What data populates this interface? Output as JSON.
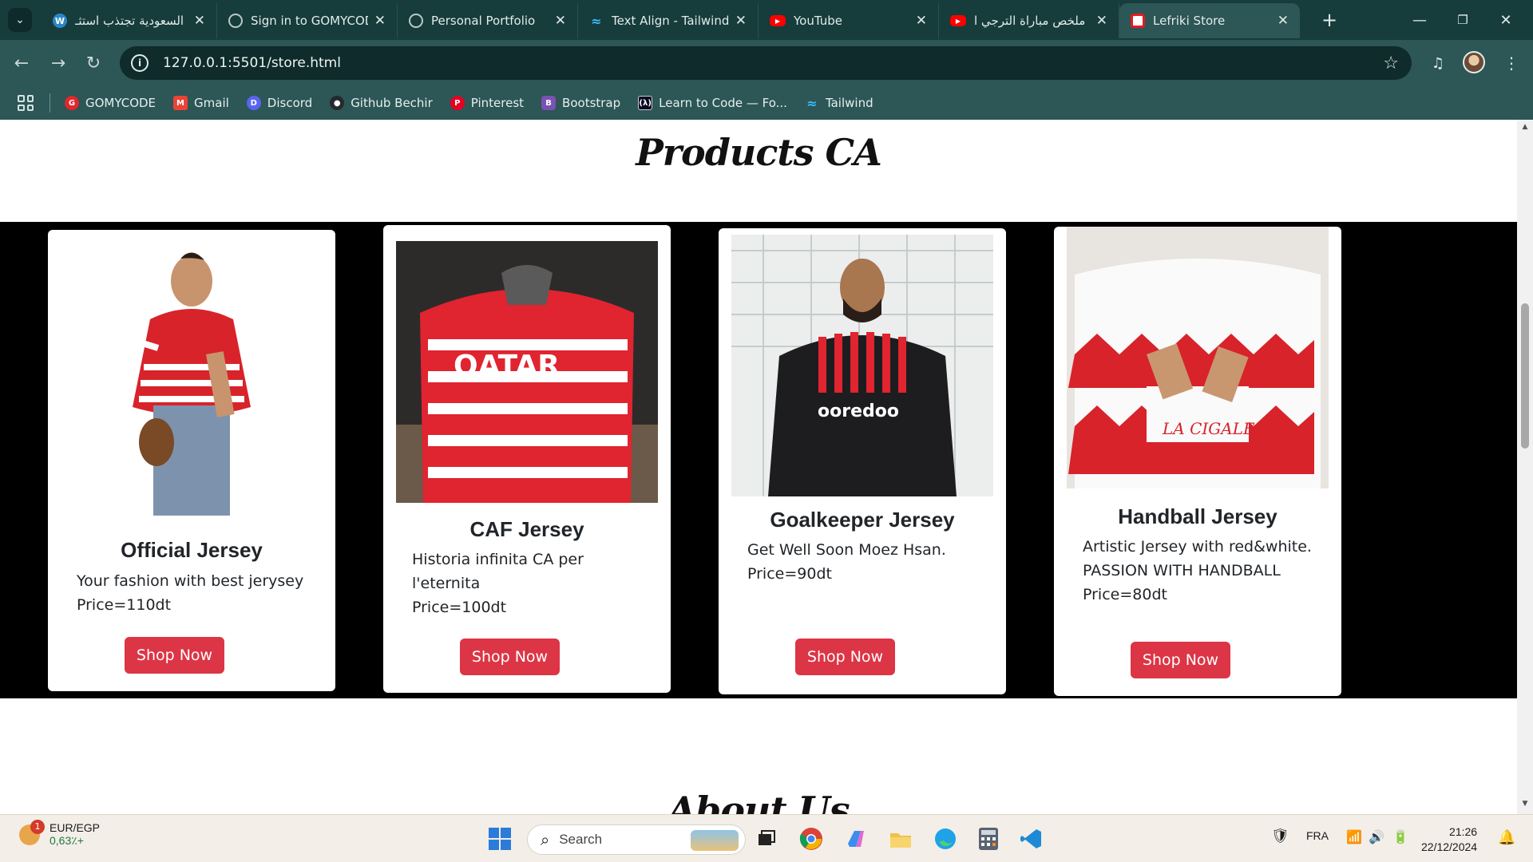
{
  "browser": {
    "tabs": [
      {
        "title": "السعودية تجتذب استثـ",
        "icon": "wordpress-icon",
        "favColor": "#2a86c7"
      },
      {
        "title": "Sign in to GOMYCODE",
        "icon": "globe-icon",
        "favColor": "#6a8a88"
      },
      {
        "title": "Personal Portfolio",
        "icon": "globe-icon",
        "favColor": "#6a8a88"
      },
      {
        "title": "Text Align - Tailwind C",
        "icon": "tailwind-icon",
        "favColor": "#38bdf8"
      },
      {
        "title": "YouTube",
        "icon": "youtube-icon",
        "favColor": "#ff0000"
      },
      {
        "title": "ملخص مباراة الترجي ا",
        "icon": "youtube-icon",
        "favColor": "#ff0000"
      },
      {
        "title": "Lefriki Store",
        "icon": "club-africain-icon",
        "favColor": "#e31b23"
      }
    ],
    "url": "127.0.0.1:5501/store.html",
    "bookmarks": [
      {
        "label": "GOMYCODE",
        "color": "#e0272e"
      },
      {
        "label": "Gmail",
        "color": "#ea4335"
      },
      {
        "label": "Discord",
        "color": "#5865f2"
      },
      {
        "label": "Github Bechir",
        "color": "#24292e"
      },
      {
        "label": "Pinterest",
        "color": "#e60023"
      },
      {
        "label": "Bootstrap",
        "color": "#7952b3"
      },
      {
        "label": "Learn to Code — Fo...",
        "color": "#0a0a23"
      },
      {
        "label": "Tailwind",
        "color": "#38bdf8"
      }
    ]
  },
  "page": {
    "products_title": "Products CA",
    "about_title": "About Us",
    "products": [
      {
        "name": "Official Jersey",
        "desc": "Your fashion with best jerysey",
        "price": "Price=110dt",
        "button": "Shop Now"
      },
      {
        "name": "CAF Jersey",
        "desc": "Historia infinita CA per l'eternita",
        "price": "Price=100dt",
        "button": "Shop Now"
      },
      {
        "name": "Goalkeeper Jersey",
        "desc": "Get Well Soon Moez Hsan.",
        "price": "Price=90dt",
        "button": "Shop Now"
      },
      {
        "name": "Handball Jersey",
        "desc": "Artistic Jersey with red&white. PASSION WITH HANDBALL",
        "price": "Price=80dt",
        "button": "Shop Now"
      }
    ],
    "accent": "#dc3545"
  },
  "taskbar": {
    "ticker_badge": "1",
    "ticker_name": "EUR/EGP",
    "ticker_value": "0,63٪+",
    "search_label": "Search",
    "lang": "FRA",
    "time": "21:26",
    "date": "22/12/2024"
  }
}
